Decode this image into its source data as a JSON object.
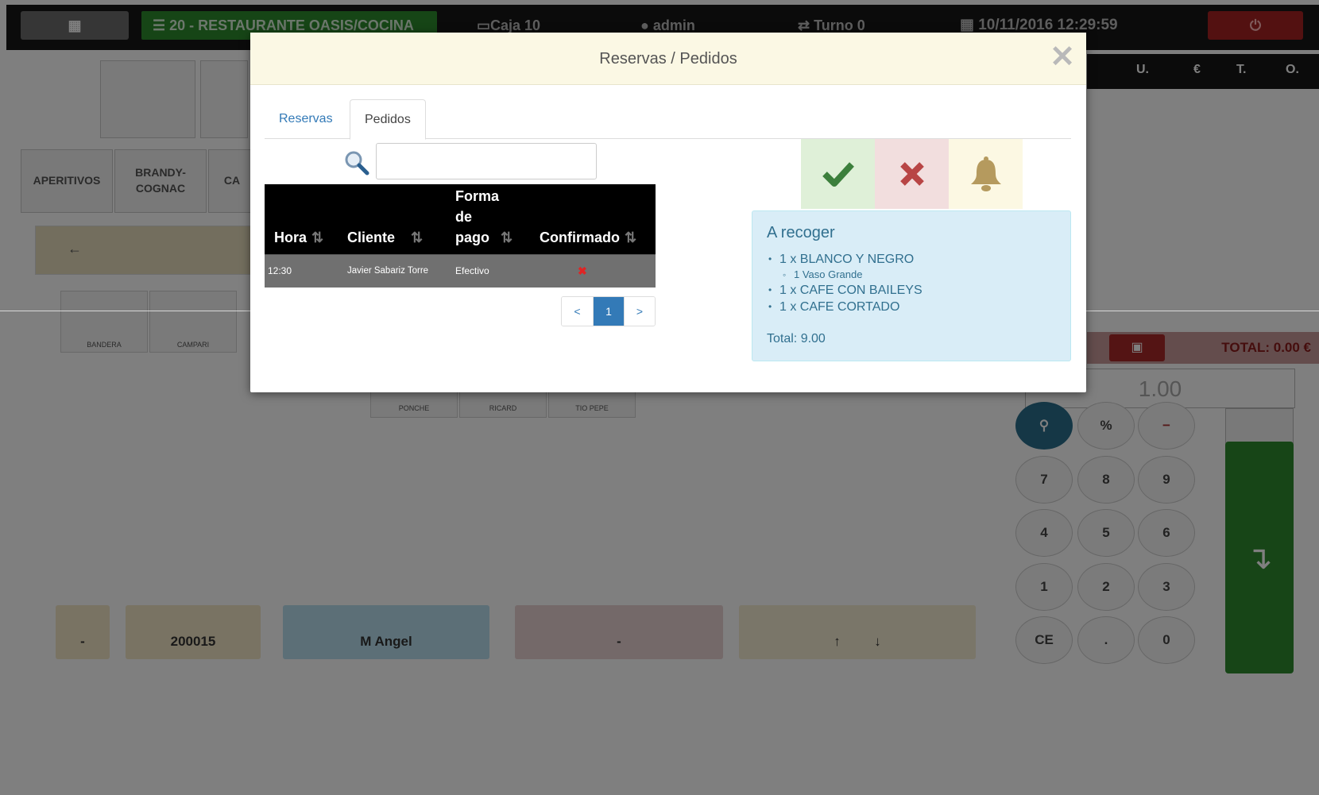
{
  "topbar": {
    "restaurant": "20 - RESTAURANTE OASIS/COCINA",
    "caja": "Caja 10",
    "user": "admin",
    "turno": "Turno 0",
    "datetime": "10/11/2016 12:29:59"
  },
  "columns": [
    "U.",
    "€",
    "T.",
    "O."
  ],
  "categories": [
    "APERITIVOS",
    "BRANDY-\nCOGNAC",
    "CA"
  ],
  "products": [
    "BANDERA",
    "CAMPARI",
    "PONCHE",
    "RICARD",
    "TIO PEPE"
  ],
  "total_label": "TOTAL: 0.00 €",
  "quantity": "1.00",
  "keypad": [
    "%",
    "−",
    "7",
    "8",
    "9",
    "4",
    "5",
    "6",
    "1",
    "2",
    "3",
    "CE",
    ".",
    "0"
  ],
  "bottom": {
    "ticket": "200015",
    "waiter": "M Angel",
    "dash1": "-",
    "dash2": "-"
  },
  "modal": {
    "title": "Reservas / Pedidos",
    "close": "✕",
    "tabs": {
      "reservas": "Reservas",
      "pedidos": "Pedidos"
    },
    "search_value": "",
    "table": {
      "headers": {
        "hora": "Hora",
        "cliente": "Cliente",
        "forma_line1": "Forma",
        "forma_line2": "de",
        "forma_line3": "pago",
        "confirmado": "Confirmado"
      },
      "rows": [
        {
          "hora": "12:30",
          "cliente": "Javier Sabariz Torre",
          "forma": "Efectivo",
          "confirmado": "✖"
        }
      ]
    },
    "pagination": {
      "prev": "<",
      "current": "1",
      "next": ">"
    },
    "detail": {
      "heading": "A recoger",
      "items": [
        {
          "text": "1 x BLANCO Y NEGRO",
          "sub": "1 Vaso Grande"
        },
        {
          "text": "1 x CAFE CON BAILEYS"
        },
        {
          "text": "1 x CAFE CORTADO"
        }
      ],
      "total": "Total: 9.00"
    }
  }
}
